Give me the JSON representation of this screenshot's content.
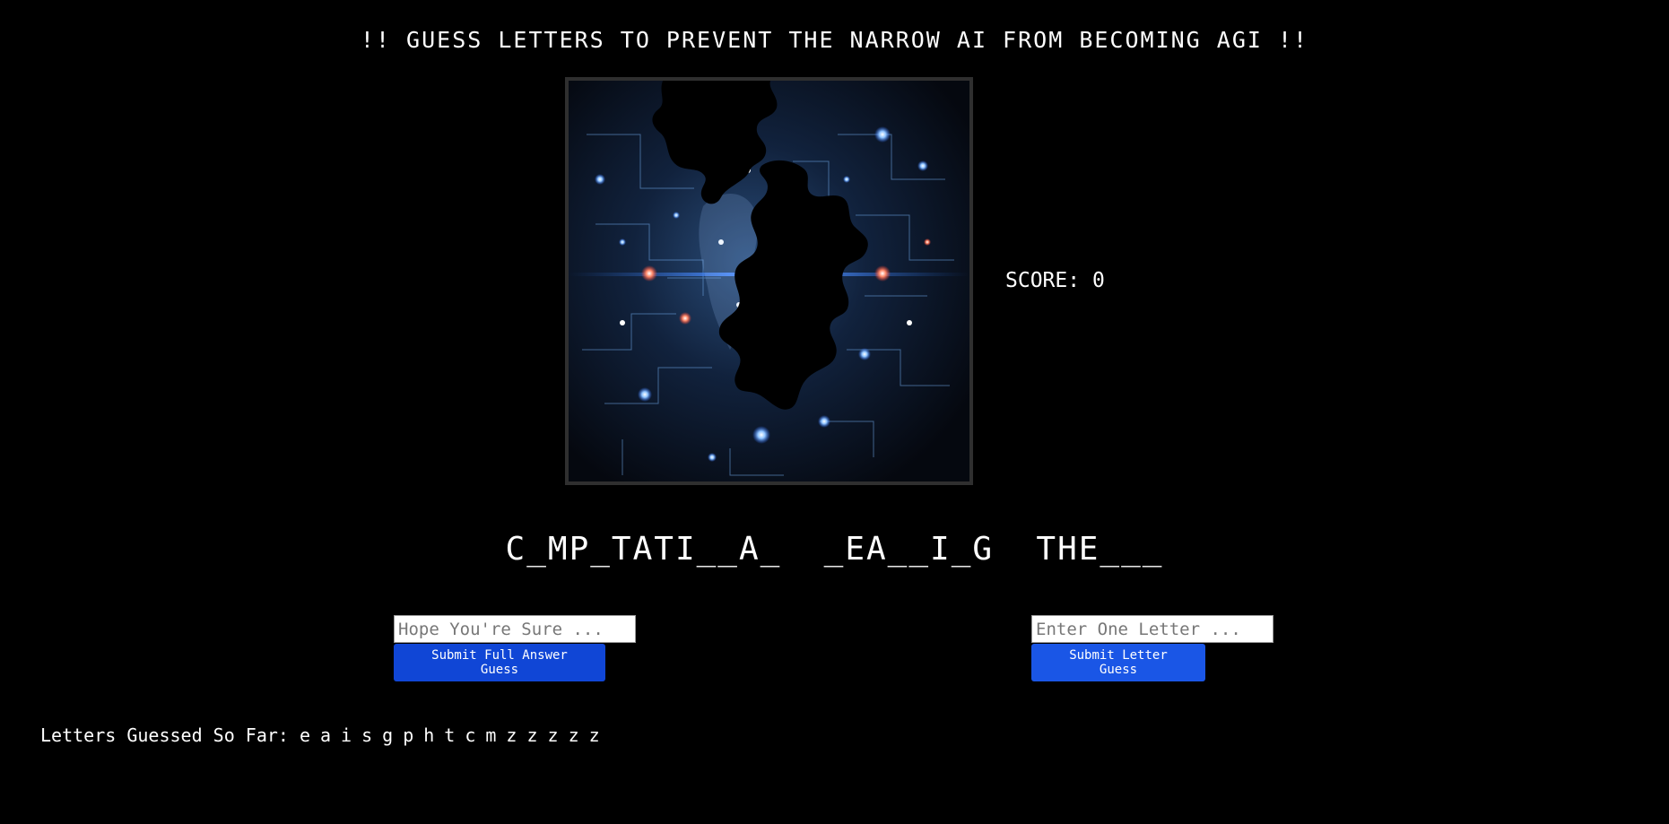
{
  "header": {
    "title": "!! GUESS LETTERS TO PREVENT THE NARROW AI FROM BECOMING AGI !!"
  },
  "score": {
    "label": "SCORE:",
    "value": "0"
  },
  "puzzle": {
    "masked_answer": "C_MP_TATI__A_  _EA__I_G  THE___"
  },
  "full_guess": {
    "placeholder": "Hope You're Sure ...",
    "value": "",
    "button_label": "Submit Full Answer Guess"
  },
  "letter_guess": {
    "placeholder": "Enter One Letter ...",
    "value": "",
    "button_label": "Submit Letter Guess"
  },
  "guessed": {
    "label": "Letters Guessed So Far:",
    "letters": [
      "e",
      "a",
      "i",
      "s",
      "g",
      "p",
      "h",
      "t",
      "c",
      "m",
      "z",
      "z",
      "z",
      "z",
      "z"
    ]
  },
  "colors": {
    "background": "#000000",
    "button_full": "#1046d6",
    "button_letter": "#1a56e6",
    "frame_border": "#2f2f2f"
  },
  "icons": {
    "puzzle_image": "circuit-brain-jigsaw-image"
  }
}
